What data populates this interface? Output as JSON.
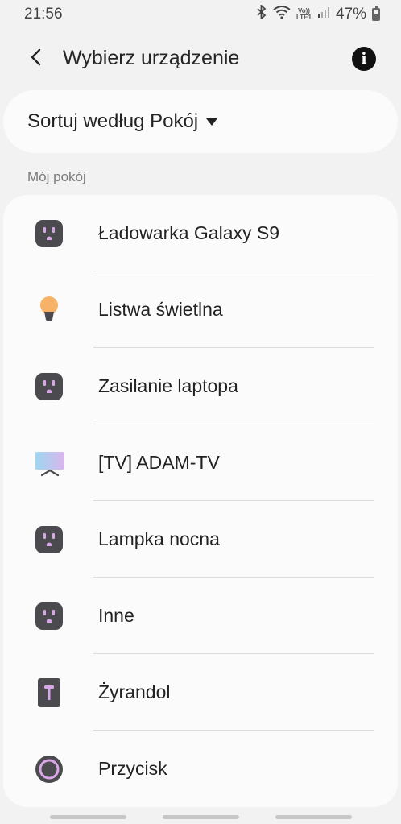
{
  "status_bar": {
    "time": "21:56",
    "volte_top": "Vo))",
    "volte_bottom": "LTE1",
    "battery_percent": "47%",
    "icons": [
      "bluetooth-icon",
      "wifi-icon",
      "volte-icon",
      "signal-icon",
      "battery-icon"
    ]
  },
  "app_bar": {
    "title": "Wybierz urządzenie",
    "back_icon": "back-arrow-icon",
    "info_icon": "info-icon",
    "info_glyph": "i"
  },
  "sort": {
    "label": "Sortuj według Pokój"
  },
  "section": {
    "title": "Mój pokój"
  },
  "devices": [
    {
      "label": "Ładowarka Galaxy S9",
      "icon": "smart-plug-icon"
    },
    {
      "label": "Listwa świetlna",
      "icon": "light-bulb-icon"
    },
    {
      "label": "Zasilanie laptopa",
      "icon": "smart-plug-icon"
    },
    {
      "label": "[TV] ADAM-TV",
      "icon": "tv-icon"
    },
    {
      "label": "Lampka nocna",
      "icon": "smart-plug-icon"
    },
    {
      "label": "Inne",
      "icon": "smart-plug-icon"
    },
    {
      "label": "Żyrandol",
      "icon": "wall-switch-icon"
    },
    {
      "label": "Przycisk",
      "icon": "button-icon"
    }
  ],
  "colors": {
    "background": "#f2f2f2",
    "card": "#fbfbfb",
    "plug_body": "#4a4a4f",
    "plug_accent": "#d9a6e8",
    "bulb": "#f7b267",
    "tv_gradient_start": "#9fd6f0",
    "tv_gradient_end": "#d8b6ec"
  }
}
